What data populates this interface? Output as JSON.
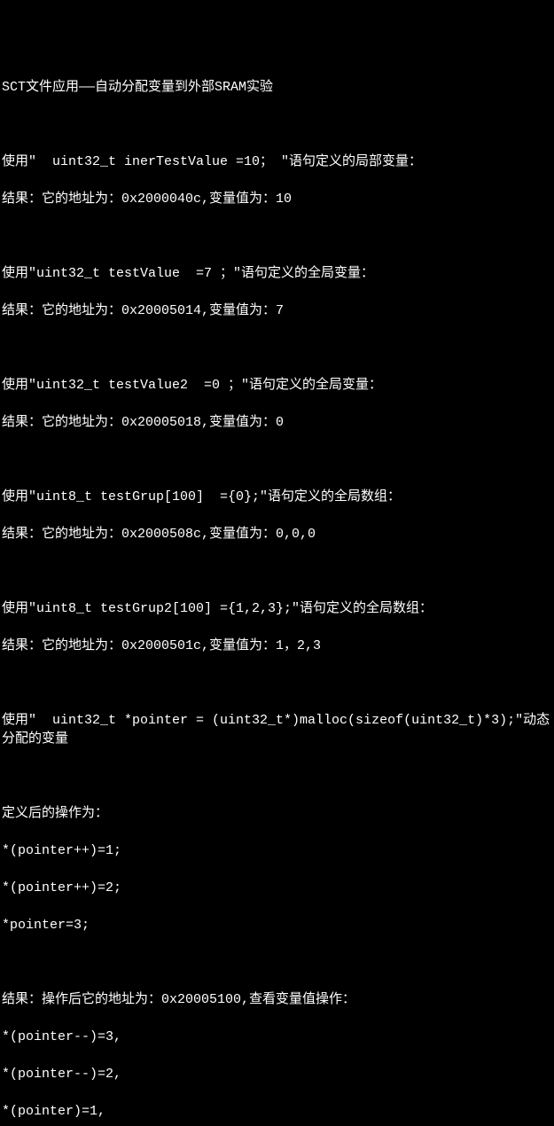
{
  "title": "SCT文件应用——自动分配变量到外部SRAM实验",
  "sections": [
    {
      "decl": "使用\"  uint32_t inerTestValue =10； \"语句定义的局部变量：",
      "result": "结果：它的地址为：0x2000040c,变量值为：10"
    },
    {
      "decl": "使用\"uint32_t testValue  =7 ；\"语句定义的全局变量：",
      "result": "结果：它的地址为：0x20005014,变量值为：7"
    },
    {
      "decl": "使用\"uint32_t testValue2  =0 ；\"语句定义的全局变量：",
      "result": "结果：它的地址为：0x20005018,变量值为：0"
    },
    {
      "decl": "使用\"uint8_t testGrup[100]  ={0};\"语句定义的全局数组：",
      "result": "结果：它的地址为：0x2000508c,变量值为：0,0,0"
    },
    {
      "decl": "使用\"uint8_t testGrup2[100] ={1,2,3};\"语句定义的全局数组：",
      "result": "结果：它的地址为：0x2000501c,变量值为：1，2,3"
    }
  ],
  "malloc_decl": "使用\"  uint32_t *pointer = (uint32_t*)malloc(sizeof(uint32_t)*3);\"动态分配的变量",
  "ops_header": "定义后的操作为：",
  "ops": [
    "*(pointer++)=1;",
    "*(pointer++)=2;",
    "*pointer=3;"
  ],
  "result_header": "结果：操作后它的地址为：0x20005100,查看变量值操作：",
  "result_ops": [
    "*(pointer--)=3,",
    "*(pointer--)=2,",
    "*(pointer)=1,"
  ]
}
